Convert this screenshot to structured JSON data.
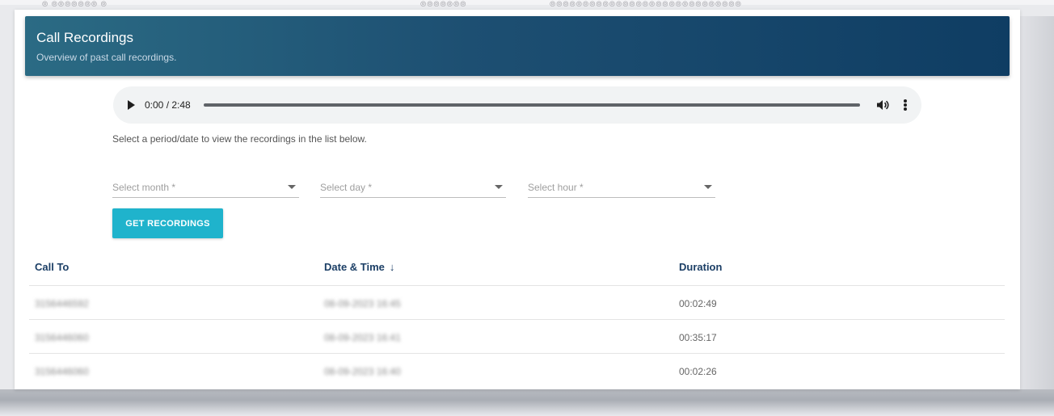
{
  "header": {
    "title": "Call Recordings",
    "subtitle": "Overview of past call recordings."
  },
  "player": {
    "time": "0:00 / 2:48"
  },
  "instruction": "Select a period/date to view the recordings in the list below.",
  "filters": {
    "month_label": "Select month *",
    "day_label": "Select day *",
    "hour_label": "Select hour *"
  },
  "actions": {
    "get_recordings": "GET RECORDINGS"
  },
  "table": {
    "columns": [
      "Call To",
      "Date & Time",
      "Duration"
    ],
    "sort_indicator": "↓",
    "rows": [
      {
        "call_to": "3156446592",
        "datetime": "08-09-2023 16:45",
        "duration": "00:02:49"
      },
      {
        "call_to": "3156446060",
        "datetime": "08-09-2023 16:41",
        "duration": "00:35:17"
      },
      {
        "call_to": "3156446060",
        "datetime": "08-09-2023 16:40",
        "duration": "00:02:26"
      }
    ]
  },
  "icons": {
    "play": "play-icon",
    "volume": "volume-icon",
    "more": "more-vert-icon",
    "dropdown": "chevron-down-icon",
    "sort": "arrow-down-icon"
  },
  "colors": {
    "header_start": "#2b6b84",
    "header_end": "#0f3d63",
    "button": "#1fb3cc",
    "column_header": "#1c3f66"
  }
}
